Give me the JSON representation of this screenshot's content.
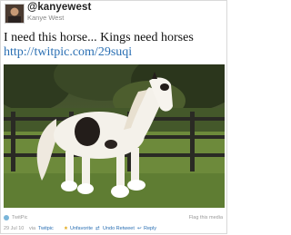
{
  "tweet": {
    "screen_name": "@kanyewest",
    "full_name": "Kanye West",
    "text": "I need this horse... Kings need horses",
    "link": "http://twitpic.com/29suqi"
  },
  "media": {
    "source": "TwitPic",
    "flag_label": "Flag this media"
  },
  "meta": {
    "date": "29 Jul 10",
    "via_label": "via",
    "via_source": "Twitpic",
    "unfavorite_label": "Unfavorite",
    "undo_retweet_label": "Undo Retweet",
    "reply_label": "Reply"
  },
  "colors": {
    "link": "#2a6fb3",
    "favorite_star": "#e2a817"
  }
}
